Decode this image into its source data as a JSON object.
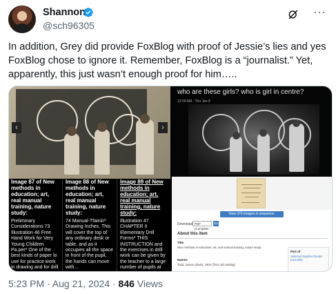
{
  "author": {
    "name": "Shannon",
    "handle": "@sch96305"
  },
  "icons": {
    "verified": "verified-badge-icon",
    "grok": "grok-icon",
    "more": "more-icon",
    "avatar": "avatar"
  },
  "colors": {
    "verified_blue": "#1d9bf0",
    "text_primary": "#0f1419",
    "text_secondary": "#536471",
    "link_blue": "#3e7cc4"
  },
  "tweet": {
    "text": "In addition, Grey did provide FoxBlog with proof of Jessie’s lies and yes FoxBlog chose to ignore it. Remember, FoxBlog is a “journalist.” Yet, apparently, this just wasn’t enough proof for him….."
  },
  "media_left": {
    "columns": [
      {
        "title": "Image 87 of New methods in education; art, real manual training, nature study:",
        "body": "Preliminary Considerations 73 Illustration 46 Free Hand Work for Very Young Children Pa.per* One of the best kinds of paper lo use for practice work in drawing and for drill work is..."
      },
      {
        "title": "Image 88 of New methods in education; art, real manual training, nature study:",
        "body": "74 Manual-Tfainin* Drawing Inches. This will cover the top of any ordinary desk or table, and as it occupies all the space in front of the pupil, the hands can move with..."
      },
      {
        "title": "Image 89 of New methods in education; art, real manual training, nature study:",
        "body": "Illustration 47 CHAPTER II Elementary Drill Forms* THIS INSTRUCTION and the exercises in drill work can be given by the teacher to a large number of pupils at once. This will save..."
      }
    ]
  },
  "media_right": {
    "screen_title": "who are these girls?  who is girl in centre?",
    "screen_meta": "12:00 AM · Thu Jan 9",
    "view_button": "View 370 images in sequence.",
    "download_label": "Download:",
    "download_select": "PDF (Complete",
    "download_go": "Go",
    "about_heading": "About this item",
    "fields": [
      {
        "label": "Title",
        "value": "New methods in education; art, real manual training, nature study."
      },
      {
        "label": "Names",
        "value": "Todd, James Liberty, 1904- [from old catalog]"
      }
    ],
    "part_of_label": "Part of",
    "part_of_value": "Selected Digitized Books (116,896)"
  },
  "footer": {
    "time": "5:23 PM · Aug 21, 2024 · ",
    "views_count": "846",
    "views_label": " Views"
  }
}
